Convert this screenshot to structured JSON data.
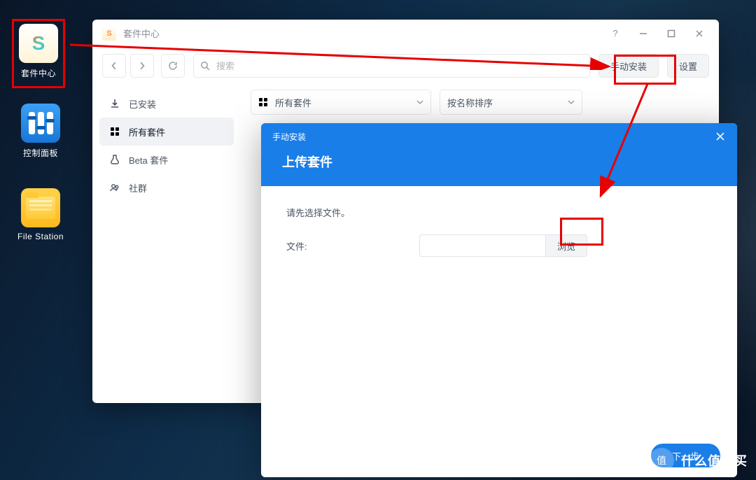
{
  "desktop": {
    "package_center": "套件中心",
    "control_panel": "控制面板",
    "file_station": "File Station"
  },
  "window": {
    "title": "套件中心",
    "search_placeholder": "搜索",
    "manual_install": "手动安装",
    "settings": "设置"
  },
  "sidebar": {
    "installed": "已安装",
    "all_packages": "所有套件",
    "beta": "Beta 套件",
    "community": "社群"
  },
  "filters": {
    "all_packages": "所有套件",
    "sort": "按名称排序"
  },
  "modal": {
    "breadcrumb": "手动安装",
    "title": "上传套件",
    "hint": "请先选择文件。",
    "file_label": "文件:",
    "browse": "浏览",
    "next": "下一步"
  },
  "watermark": {
    "circle": "值",
    "text": "什么值得买"
  }
}
